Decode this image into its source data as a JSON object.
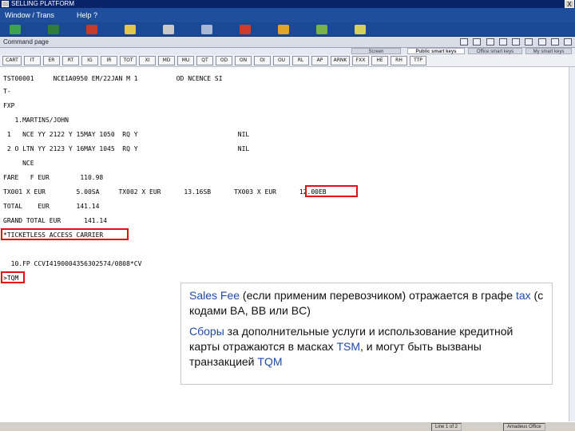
{
  "window": {
    "title": "SELLING PLATFORM",
    "close_label": "X"
  },
  "menu": {
    "items": [
      "Window / Trans",
      "Help ?"
    ]
  },
  "toolbar_icons": [
    {
      "name": "map-icon",
      "color": "#3fa34d"
    },
    {
      "name": "document-icon",
      "color": "#2f7d3a"
    },
    {
      "name": "person-icon",
      "color": "#c43b2b"
    },
    {
      "name": "calculator-icon",
      "color": "#e2c84a"
    },
    {
      "name": "table-icon",
      "color": "#c9c9c9"
    },
    {
      "name": "bus-icon",
      "color": "#a9b8d6"
    },
    {
      "name": "flag-icon",
      "color": "#d23a2a"
    },
    {
      "name": "tree-icon",
      "color": "#e1a426"
    },
    {
      "name": "leaf-icon",
      "color": "#78b24b"
    },
    {
      "name": "star-icon",
      "color": "#d6d15a"
    }
  ],
  "command_page": {
    "title": "Command page"
  },
  "tabs": [
    "Screen",
    "Public smart keys",
    "Office smart keys",
    "My smart keys"
  ],
  "quick_buttons": [
    "CART",
    "IT",
    "ER",
    "RT",
    "IG",
    "IR",
    "TOT",
    "XI",
    "MD",
    "MU",
    "QT",
    "OD",
    "ON",
    "OI",
    "OU",
    "RL",
    "AP",
    "ARNK",
    "FXX",
    "HE",
    "RH",
    "TTP"
  ],
  "terminal": {
    "lines": [
      "TST00001     NCE1A0950 EM/22JAN M 1          OD NCENCE SI",
      "T-",
      "FXP",
      "   1.MARTINS/JOHN",
      " 1   NCE YY 2122 Y 15MAY 1050  RQ Y                          NIL",
      " 2 O LTN YY 2123 Y 16MAY 1045  RQ Y                          NIL",
      "     NCE",
      "FARE   F EUR        110.98",
      "TX001 X EUR        5.00SA     TX002 X EUR      13.16SB      TX003 X EUR      12.00EB",
      "TOTAL    EUR       141.14",
      "GRAND TOTAL EUR      141.14",
      "*TICKETLESS ACCESS CARRIER",
      "",
      "  10.FP CCVI4190004356302574/0808*CV",
      ">TQM"
    ]
  },
  "callout": {
    "p1_a": "Sales Fee",
    "p1_b": " (если применим перевозчиком) отражается в графе ",
    "p1_c": "tax",
    "p1_d": " (с кодами BA, BB или BC)",
    "p2_a": "Сборы",
    "p2_b": " за дополнительные услуги и использование кредитной карты отражаются в масках ",
    "p2_c": "TSM",
    "p2_d": ", и могут быть вызваны транзакцией ",
    "p2_e": "TQM"
  },
  "status": {
    "page": "Line 1 of 2",
    "mode": "Amadeus Office"
  }
}
